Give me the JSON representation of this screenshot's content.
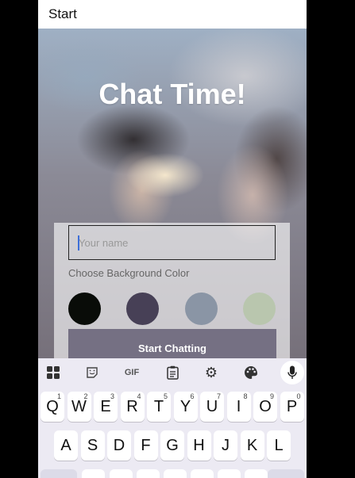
{
  "appbar": {
    "title": "Start"
  },
  "hero": {
    "title": "Chat Time!"
  },
  "form": {
    "name_placeholder": "Your name",
    "choose_label": "Choose Background Color",
    "colors": [
      "#090C08",
      "#474056",
      "#8A95A5",
      "#B9C6AE"
    ],
    "start_button": "Start Chatting"
  },
  "keyboard": {
    "toolbar": {
      "apps_icon": "grid-apps-icon",
      "sticker_icon": "sticker-icon",
      "gif_label": "GIF",
      "clipboard_icon": "clipboard-icon",
      "settings_icon": "gear-icon",
      "theme_icon": "palette-icon",
      "mic_icon": "microphone-icon"
    },
    "row1": [
      {
        "k": "Q",
        "h": "1"
      },
      {
        "k": "W",
        "h": "2"
      },
      {
        "k": "E",
        "h": "3"
      },
      {
        "k": "R",
        "h": "4"
      },
      {
        "k": "T",
        "h": "5"
      },
      {
        "k": "Y",
        "h": "6"
      },
      {
        "k": "U",
        "h": "7"
      },
      {
        "k": "I",
        "h": "8"
      },
      {
        "k": "O",
        "h": "9"
      },
      {
        "k": "P",
        "h": "0"
      }
    ],
    "row2": [
      "A",
      "S",
      "D",
      "F",
      "G",
      "H",
      "J",
      "K",
      "L"
    ]
  }
}
